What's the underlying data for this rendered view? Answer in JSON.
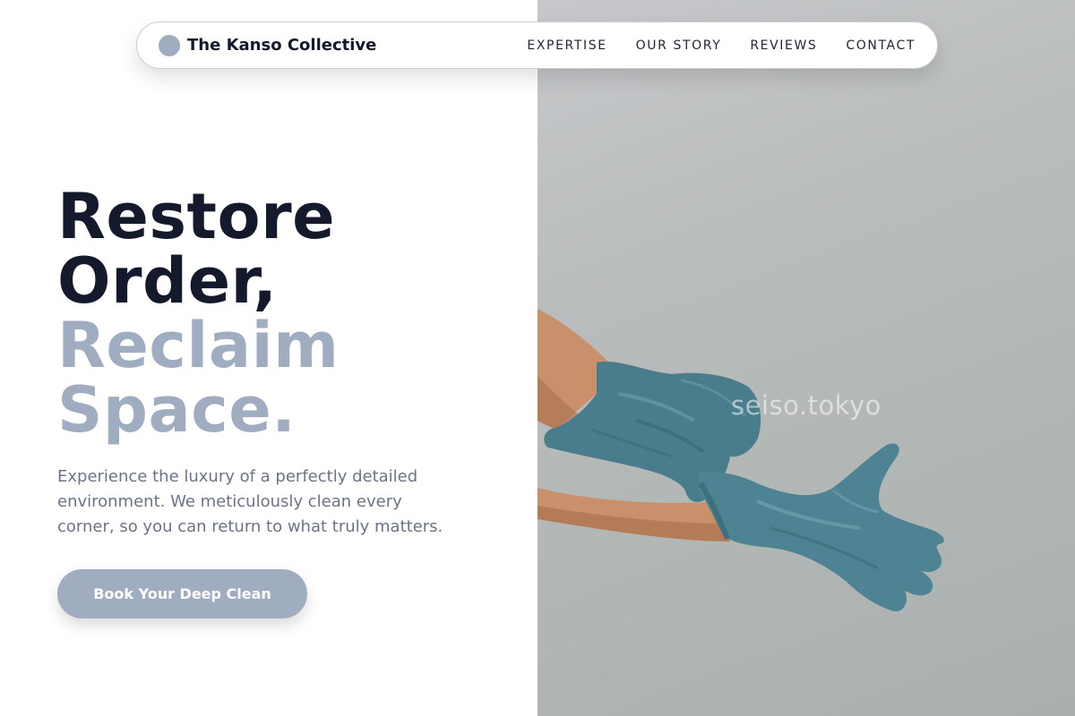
{
  "brand": {
    "name": "The Kanso Collective"
  },
  "nav": {
    "links": [
      "EXPERTISE",
      "OUR STORY",
      "REVIEWS",
      "CONTACT"
    ]
  },
  "hero": {
    "headline": {
      "line1": "Restore",
      "line2": "Order,",
      "line3": "Reclaim",
      "line4": "Space."
    },
    "description": "Experience the luxury of a perfectly detailed environment. We meticulously clean every corner, so you can return to what truly matters.",
    "cta_label": "Book Your Deep Clean",
    "photo_watermark": "seiso.tokyo"
  },
  "colors": {
    "ink": "#141a2b",
    "accent": "#a0acc0",
    "muted_text": "#6b7486",
    "glove": "#4a7d8c"
  }
}
